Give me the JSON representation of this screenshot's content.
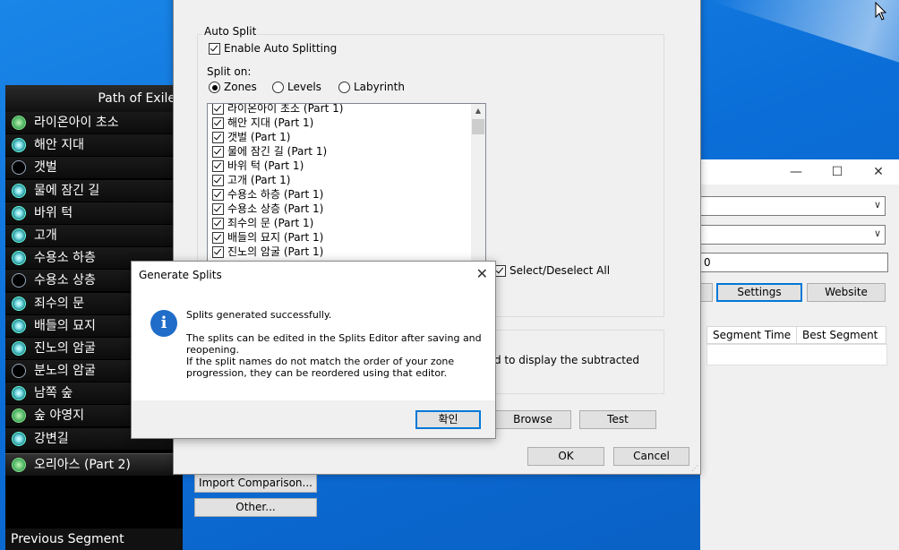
{
  "livesplit": {
    "game_title": "Path of Exile",
    "splits": [
      {
        "name": "라이온아이 초소",
        "icon": "waypoint-home-icon"
      },
      {
        "name": "해안 지대",
        "icon": "waypoint-icon"
      },
      {
        "name": "갯벌",
        "icon": "empty-circle-icon"
      },
      {
        "name": "물에 잠긴 길",
        "icon": "waypoint-icon"
      },
      {
        "name": "바위 턱",
        "icon": "waypoint-icon"
      },
      {
        "name": "고개",
        "icon": "waypoint-icon"
      },
      {
        "name": "수용소 하층",
        "icon": "waypoint-icon"
      },
      {
        "name": "수용소 상층",
        "icon": "empty-circle-icon"
      },
      {
        "name": "죄수의 문",
        "icon": "waypoint-icon"
      },
      {
        "name": "배들의 묘지",
        "icon": "waypoint-icon"
      },
      {
        "name": "진노의 암굴",
        "icon": "waypoint-icon"
      },
      {
        "name": "분노의 암굴",
        "icon": "empty-circle-icon"
      },
      {
        "name": "남쪽 숲",
        "icon": "waypoint-icon"
      },
      {
        "name": "숲 야영지",
        "icon": "waypoint-home-icon"
      },
      {
        "name": "강변길",
        "icon": "waypoint-icon"
      }
    ],
    "current_split": {
      "name": "오리아스 (Part 2)",
      "icon": "waypoint-home-icon"
    },
    "previous_segment_label": "Previous Segment"
  },
  "background_window": {
    "minimize": "—",
    "maximize": "☐",
    "close": "✕",
    "offset_value": "0",
    "settings_label": "Settings",
    "website_label": "Website",
    "columns": [
      "Segment Time",
      "Best Segment"
    ]
  },
  "settings_dialog": {
    "auto_split_group": "Auto Split",
    "enable_label": "Enable Auto Splitting",
    "split_on_label": "Split on:",
    "split_options": [
      "Zones",
      "Levels",
      "Labyrinth"
    ],
    "selected_option": "Zones",
    "zones": [
      "라이온아이 초소 (Part 1)",
      "해안 지대 (Part 1)",
      "갯벌 (Part 1)",
      "물에 잠긴 길 (Part 1)",
      "바위 턱 (Part 1)",
      "고개 (Part 1)",
      "수용소 하층 (Part 1)",
      "수용소 상층 (Part 1)",
      "죄수의 문 (Part 1)",
      "배들의 묘지 (Part 1)",
      "진노의 암굴 (Part 1)"
    ],
    "select_all_label": "Select/Deselect All",
    "subtracted_text": "d to display the subtracted",
    "browse_label": "Browse",
    "test_label": "Test",
    "ok_label": "OK",
    "cancel_label": "Cancel"
  },
  "behind_buttons": {
    "import_comparison": "Import Comparison...",
    "other": "Other..."
  },
  "message_box": {
    "title": "Generate Splits",
    "line1": "Splits generated successfully.",
    "line2": "The splits can be edited in the Splits Editor after saving and reopening.",
    "line3": "If the split names do not match the order of your zone progression, they can be reordered using that editor.",
    "ok_label": "확인"
  }
}
